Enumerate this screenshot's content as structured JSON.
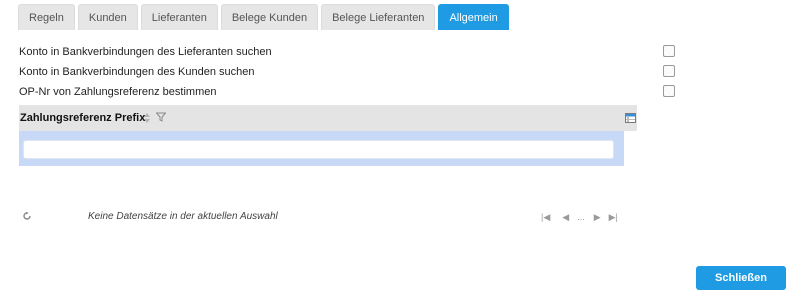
{
  "tabs": [
    {
      "label": "Regeln",
      "active": false
    },
    {
      "label": "Kunden",
      "active": false
    },
    {
      "label": "Lieferanten",
      "active": false
    },
    {
      "label": "Belege Kunden",
      "active": false
    },
    {
      "label": "Belege Lieferanten",
      "active": false
    },
    {
      "label": "Allgemein",
      "active": true
    }
  ],
  "options": [
    {
      "label": "Konto in Bankverbindungen des Lieferanten suchen",
      "checked": false
    },
    {
      "label": "Konto in Bankverbindungen des Kunden suchen",
      "checked": false
    },
    {
      "label": "OP-Nr von Zahlungsreferenz bestimmen",
      "checked": false
    }
  ],
  "grid": {
    "column_title": "Zahlungsreferenz Prefix",
    "filter_value": "",
    "icons": {
      "sort": "sort-icon",
      "filter": "filter-funnel-icon",
      "settings": "column-settings-icon"
    }
  },
  "footer": {
    "status_text": "Keine Datensätze in der aktuellen Auswahl",
    "pager_ellipsis": "..."
  },
  "close_button": "Schließen",
  "colors": {
    "accent": "#1e9be3",
    "filter_band": "#c7d9f7",
    "header_bg": "#e4e4e4",
    "tab_bg": "#e6e6e6"
  }
}
